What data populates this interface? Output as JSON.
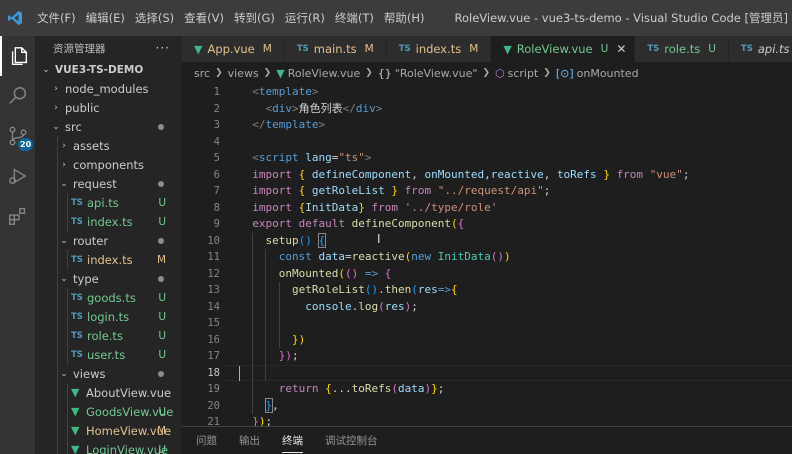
{
  "window": {
    "title": "RoleView.vue - vue3-ts-demo - Visual Studio Code [管理员]",
    "menu": [
      "文件(F)",
      "编辑(E)",
      "选择(S)",
      "查看(V)",
      "转到(G)",
      "运行(R)",
      "终端(T)",
      "帮助(H)"
    ]
  },
  "activity_bar": {
    "items": [
      {
        "icon": "files-icon",
        "active": true
      },
      {
        "icon": "search-icon"
      },
      {
        "icon": "source-control-icon",
        "badge": "20"
      },
      {
        "icon": "run-debug-icon"
      },
      {
        "icon": "extensions-icon"
      }
    ]
  },
  "sidebar": {
    "header": "资源管理器",
    "more": "···",
    "tree": [
      {
        "label": "VUE3-TS-DEMO",
        "type": "root",
        "depth": 0,
        "open": true
      },
      {
        "label": "node_modules",
        "type": "folder",
        "depth": 1,
        "open": false
      },
      {
        "label": "public",
        "type": "folder",
        "depth": 1,
        "open": false
      },
      {
        "label": "src",
        "type": "folder",
        "depth": 1,
        "open": true,
        "dot": true
      },
      {
        "label": "assets",
        "type": "folder",
        "depth": 2,
        "open": false
      },
      {
        "label": "components",
        "type": "folder",
        "depth": 2,
        "open": false
      },
      {
        "label": "request",
        "type": "folder",
        "depth": 2,
        "open": true,
        "dot": true
      },
      {
        "label": "api.ts",
        "type": "ts",
        "depth": 3,
        "status": "U"
      },
      {
        "label": "index.ts",
        "type": "ts",
        "depth": 3,
        "status": "U"
      },
      {
        "label": "router",
        "type": "folder",
        "depth": 2,
        "open": true,
        "dot": true
      },
      {
        "label": "index.ts",
        "type": "ts",
        "depth": 3,
        "status": "M"
      },
      {
        "label": "type",
        "type": "folder",
        "depth": 2,
        "open": true,
        "dot": true
      },
      {
        "label": "goods.ts",
        "type": "ts",
        "depth": 3,
        "status": "U"
      },
      {
        "label": "login.ts",
        "type": "ts",
        "depth": 3,
        "status": "U"
      },
      {
        "label": "role.ts",
        "type": "ts",
        "depth": 3,
        "status": "U"
      },
      {
        "label": "user.ts",
        "type": "ts",
        "depth": 3,
        "status": "U"
      },
      {
        "label": "views",
        "type": "folder",
        "depth": 2,
        "open": true,
        "dot": true
      },
      {
        "label": "AboutView.vue",
        "type": "vue",
        "depth": 3
      },
      {
        "label": "GoodsView.vue",
        "type": "vue",
        "depth": 3,
        "status": "U"
      },
      {
        "label": "HomeView.vue",
        "type": "vue",
        "depth": 3,
        "status": "M"
      },
      {
        "label": "LoginView.vue",
        "type": "vue",
        "depth": 3,
        "status": "U"
      }
    ]
  },
  "tabs": [
    {
      "label": "App.vue",
      "type": "vue",
      "status": "M"
    },
    {
      "label": "main.ts",
      "type": "ts",
      "status": "M"
    },
    {
      "label": "index.ts",
      "type": "ts",
      "status": "M"
    },
    {
      "label": "RoleView.vue",
      "type": "vue",
      "status": "U",
      "active": true,
      "close": "✕"
    },
    {
      "label": "role.ts",
      "type": "ts",
      "status": "U"
    },
    {
      "label": "api.ts",
      "type": "ts",
      "status": "",
      "italic": true
    }
  ],
  "breadcrumb": [
    "src",
    "views",
    "RoleView.vue",
    "\"RoleView.vue\"",
    "script",
    "onMounted"
  ],
  "editor": {
    "current_line": 18,
    "lines": [
      {
        "n": "1",
        "t": [
          [
            "  ",
            ""
          ],
          [
            "<",
            "ang"
          ],
          [
            "template",
            "tag"
          ],
          [
            ">",
            "ang"
          ]
        ]
      },
      {
        "n": "2",
        "t": [
          [
            "    ",
            ""
          ],
          [
            "<",
            "ang"
          ],
          [
            "div",
            "tag"
          ],
          [
            ">",
            "ang"
          ],
          [
            "角色列表",
            ""
          ],
          [
            "</",
            "ang"
          ],
          [
            "div",
            "tag"
          ],
          [
            ">",
            "ang"
          ]
        ]
      },
      {
        "n": "3",
        "t": [
          [
            "  ",
            ""
          ],
          [
            "</",
            "ang"
          ],
          [
            "template",
            "tag"
          ],
          [
            ">",
            "ang"
          ]
        ]
      },
      {
        "n": "4",
        "t": []
      },
      {
        "n": "5",
        "t": [
          [
            "  ",
            ""
          ],
          [
            "<",
            "ang"
          ],
          [
            "script",
            "tag"
          ],
          [
            " ",
            ""
          ],
          [
            "lang",
            "attr"
          ],
          [
            "=",
            ""
          ],
          [
            "\"ts\"",
            "s"
          ],
          [
            ">",
            "ang"
          ]
        ]
      },
      {
        "n": "6",
        "t": [
          [
            "  ",
            ""
          ],
          [
            "import",
            "kc"
          ],
          [
            " ",
            ""
          ],
          [
            "{",
            "br1"
          ],
          [
            " ",
            ""
          ],
          [
            "defineComponent",
            "v"
          ],
          [
            ", ",
            ""
          ],
          [
            "onMounted",
            "v"
          ],
          [
            ",",
            ""
          ],
          [
            "reactive",
            "v"
          ],
          [
            ", ",
            ""
          ],
          [
            "toRefs",
            "v"
          ],
          [
            " ",
            ""
          ],
          [
            "}",
            "br1"
          ],
          [
            " ",
            ""
          ],
          [
            "from",
            "kc"
          ],
          [
            " ",
            ""
          ],
          [
            "\"vue\"",
            "s"
          ],
          [
            ";",
            ""
          ]
        ]
      },
      {
        "n": "7",
        "t": [
          [
            "  ",
            ""
          ],
          [
            "import",
            "kc"
          ],
          [
            " ",
            ""
          ],
          [
            "{",
            "br1"
          ],
          [
            " ",
            ""
          ],
          [
            "getRoleList",
            "v"
          ],
          [
            " ",
            ""
          ],
          [
            "}",
            "br1"
          ],
          [
            " ",
            ""
          ],
          [
            "from",
            "kc"
          ],
          [
            " ",
            ""
          ],
          [
            "\"../request/api\"",
            "s"
          ],
          [
            ";",
            ""
          ]
        ]
      },
      {
        "n": "8",
        "t": [
          [
            "  ",
            ""
          ],
          [
            "import",
            "kc"
          ],
          [
            " ",
            ""
          ],
          [
            "{",
            "br1"
          ],
          [
            "InitData",
            "v"
          ],
          [
            "}",
            "br1"
          ],
          [
            " ",
            ""
          ],
          [
            "from",
            "kc"
          ],
          [
            " ",
            ""
          ],
          [
            "'../type/role'",
            "s"
          ]
        ]
      },
      {
        "n": "9",
        "t": [
          [
            "  ",
            ""
          ],
          [
            "export",
            "kc"
          ],
          [
            " ",
            ""
          ],
          [
            "default",
            "kc"
          ],
          [
            " ",
            ""
          ],
          [
            "defineComponent",
            "f"
          ],
          [
            "(",
            "br1"
          ],
          [
            "{",
            "br2"
          ]
        ]
      },
      {
        "n": "10",
        "t": [
          [
            "    ",
            ""
          ],
          [
            "setup",
            "f"
          ],
          [
            "()",
            "br3"
          ],
          [
            " ",
            ""
          ],
          [
            "{",
            "br3 bm"
          ]
        ]
      },
      {
        "n": "11",
        "t": [
          [
            "      ",
            ""
          ],
          [
            "const",
            "k"
          ],
          [
            " ",
            ""
          ],
          [
            "data",
            "v"
          ],
          [
            "=",
            ""
          ],
          [
            "reactive",
            "f"
          ],
          [
            "(",
            "br1"
          ],
          [
            "new",
            "k"
          ],
          [
            " ",
            ""
          ],
          [
            "InitData",
            "c"
          ],
          [
            "()",
            "br2"
          ],
          [
            ")",
            "br1"
          ]
        ]
      },
      {
        "n": "12",
        "t": [
          [
            "      ",
            ""
          ],
          [
            "onMounted",
            "f"
          ],
          [
            "(",
            "br1"
          ],
          [
            "()",
            "br2"
          ],
          [
            " ",
            ""
          ],
          [
            "=>",
            "k"
          ],
          [
            " ",
            ""
          ],
          [
            "{",
            "br2"
          ]
        ]
      },
      {
        "n": "13",
        "t": [
          [
            "        ",
            ""
          ],
          [
            "getRoleList",
            "f"
          ],
          [
            "()",
            "br3"
          ],
          [
            ".",
            ""
          ],
          [
            "then",
            "f"
          ],
          [
            "(",
            "br3"
          ],
          [
            "res",
            "v"
          ],
          [
            "=>",
            "k"
          ],
          [
            "{",
            "br1"
          ]
        ]
      },
      {
        "n": "14",
        "t": [
          [
            "          ",
            ""
          ],
          [
            "console",
            "v"
          ],
          [
            ".",
            ""
          ],
          [
            "log",
            "f"
          ],
          [
            "(",
            "br2"
          ],
          [
            "res",
            "v"
          ],
          [
            ")",
            "br2"
          ],
          [
            ";",
            ""
          ]
        ]
      },
      {
        "n": "15",
        "t": []
      },
      {
        "n": "16",
        "t": [
          [
            "        ",
            ""
          ],
          [
            "})",
            "br1"
          ]
        ]
      },
      {
        "n": "17",
        "t": [
          [
            "      ",
            ""
          ],
          [
            "})",
            "br2"
          ],
          [
            ";",
            ""
          ]
        ]
      },
      {
        "n": "18",
        "t": []
      },
      {
        "n": "19",
        "t": [
          [
            "      ",
            ""
          ],
          [
            "return",
            "kc"
          ],
          [
            " ",
            ""
          ],
          [
            "{",
            "br1"
          ],
          [
            "...",
            ""
          ],
          [
            "toRefs",
            "f"
          ],
          [
            "(",
            "br2"
          ],
          [
            "data",
            "v"
          ],
          [
            ")",
            "br2"
          ],
          [
            "}",
            "br1"
          ],
          [
            ";",
            ""
          ]
        ]
      },
      {
        "n": "20",
        "t": [
          [
            "    ",
            ""
          ],
          [
            "}",
            "br3 bm"
          ],
          [
            ",",
            ""
          ]
        ]
      },
      {
        "n": "21",
        "t": [
          [
            "  ",
            ""
          ],
          [
            "}",
            "br2"
          ],
          [
            ")",
            "br1"
          ],
          [
            ";",
            ""
          ]
        ]
      }
    ]
  },
  "panel": {
    "tabs": [
      "问题",
      "输出",
      "终端",
      "调试控制台"
    ],
    "active": "终端"
  },
  "colors": {
    "titlebar": "#3c3c3c",
    "activity_bar": "#333333",
    "sidebar": "#252526",
    "editor_bg": "#1e1e1e",
    "status_modified": "#e2c08d",
    "status_untracked": "#73c991",
    "vue_green": "#41b883",
    "ts_blue": "#519aba",
    "badge_blue": "#0e639c"
  }
}
